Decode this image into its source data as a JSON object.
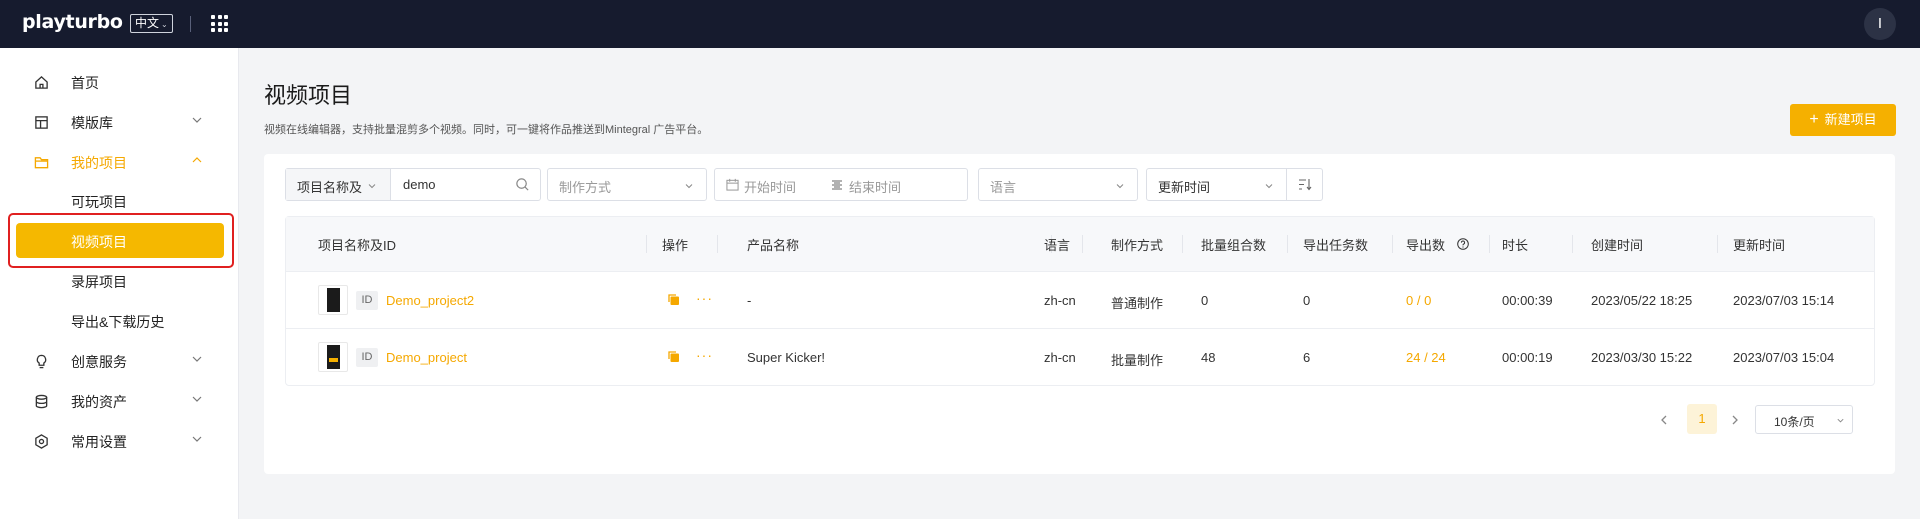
{
  "header": {
    "logo": "playturbo",
    "language": "中文",
    "avatar_initial": "I",
    "colors": {
      "bar": "#161b2e",
      "accent": "#f5b800"
    }
  },
  "sidebar": {
    "items": [
      {
        "label": "首页",
        "icon": "home-icon"
      },
      {
        "label": "模版库",
        "icon": "template-icon"
      },
      {
        "label": "我的项目",
        "icon": "folder-icon"
      },
      {
        "label": "创意服务",
        "icon": "lightbulb-icon"
      },
      {
        "label": "我的资产",
        "icon": "database-icon"
      },
      {
        "label": "常用设置",
        "icon": "settings-icon"
      }
    ],
    "subitems": [
      "可玩项目",
      "视频项目",
      "录屏项目",
      "导出&下载历史"
    ],
    "selected_subitem": "视频项目"
  },
  "main": {
    "title": "视频项目",
    "description": "视频在线编辑器，支持批量混剪多个视频。同时，可一键将作品推送到Mintegral 广告平台。",
    "new_button": "新建项目",
    "filters": {
      "name_select": "项目名称及",
      "search_value": "demo",
      "mode_placeholder": "制作方式",
      "start_placeholder": "开始时间",
      "end_placeholder": "结束时间",
      "language_placeholder": "语言",
      "sort_select": "更新时间"
    },
    "table": {
      "columns": [
        "项目名称及ID",
        "操作",
        "产品名称",
        "语言",
        "制作方式",
        "批量组合数",
        "导出任务数",
        "导出数",
        "时长",
        "创建时间",
        "更新时间"
      ],
      "rows": [
        {
          "id_tag": "ID",
          "name": "Demo_project2",
          "product": "-",
          "language": "zh-cn",
          "mode": "普通制作",
          "combos": "0",
          "tasks": "0",
          "exports": "0 / 0",
          "duration": "00:00:39",
          "created": "2023/05/22 18:25",
          "updated": "2023/07/03 15:14"
        },
        {
          "id_tag": "ID",
          "name": "Demo_project",
          "product": "Super Kicker!",
          "language": "zh-cn",
          "mode": "批量制作",
          "combos": "48",
          "tasks": "6",
          "exports": "24 / 24",
          "duration": "00:00:19",
          "created": "2023/03/30 15:22",
          "updated": "2023/07/03 15:04"
        }
      ]
    },
    "pagination": {
      "current_page": "1",
      "page_size": "10条/页"
    }
  }
}
